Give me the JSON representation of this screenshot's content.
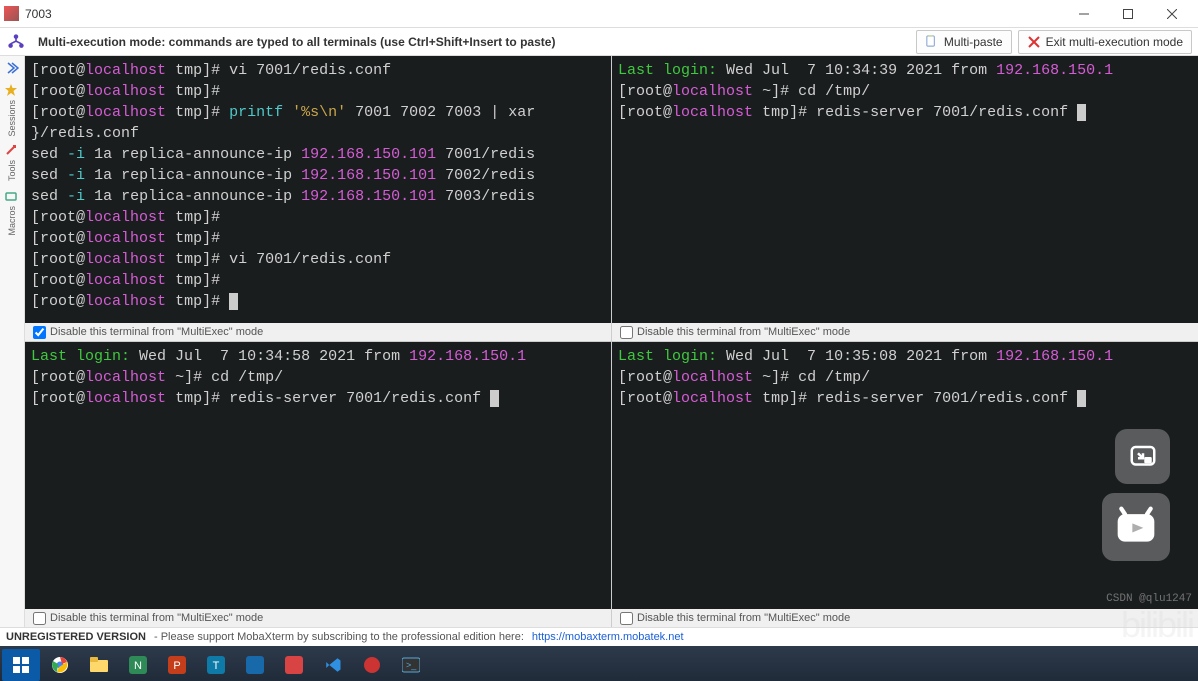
{
  "window": {
    "title": "7003"
  },
  "toolbar": {
    "mode_label": "Multi-execution mode: commands are typed to all terminals (use Ctrl+Shift+Insert to paste)",
    "multipaste_label": "Multi-paste",
    "exit_label": "Exit multi-execution mode"
  },
  "sidebar": {
    "items": [
      "Sessions",
      "Tools",
      "Macros"
    ]
  },
  "panes": [
    {
      "disable_label": "Disable this terminal from \"MultiExec\" mode",
      "disable_checked": true,
      "lines": {
        "prompt_user": "root",
        "prompt_host": "localhost",
        "prompt_path": "tmp",
        "l0_cmd": "vi 7001/redis.conf",
        "l2_cmd": "printf",
        "l2_arg1": "'%s\\n'",
        "l2_nums": "7001 7002 7003",
        "l2_pipe": "| xar",
        "l3": "}/redis.conf",
        "sed_cmd": "sed",
        "sed_flag": "-i",
        "sed_args": "1a replica-announce-ip",
        "sed_ip": "192.168.150.101",
        "sed_f1": "7001/redis",
        "sed_f2": "7002/redis",
        "sed_f3": "7003/redis",
        "l9_cmd": "vi 7001/redis.conf"
      }
    },
    {
      "disable_label": "Disable this terminal from \"MultiExec\" mode",
      "disable_checked": false,
      "lines": {
        "last_login_lbl": "Last login:",
        "last_login_date": "Wed Jul  7 10:34:39 2021 from",
        "last_login_ip": "192.168.150.1",
        "prompt_user": "root",
        "prompt_host": "localhost",
        "home_path": "~",
        "tmp_path": "tmp",
        "cd_cmd": "cd /tmp/",
        "redis_cmd": "redis-server 7001/redis.conf"
      }
    },
    {
      "disable_label": "Disable this terminal from \"MultiExec\" mode",
      "disable_checked": false,
      "lines": {
        "last_login_lbl": "Last login:",
        "last_login_date": "Wed Jul  7 10:34:58 2021 from",
        "last_login_ip": "192.168.150.1",
        "prompt_user": "root",
        "prompt_host": "localhost",
        "home_path": "~",
        "tmp_path": "tmp",
        "cd_cmd": "cd /tmp/",
        "redis_cmd": "redis-server 7001/redis.conf"
      }
    },
    {
      "disable_label": "Disable this terminal from \"MultiExec\" mode",
      "disable_checked": false,
      "lines": {
        "last_login_lbl": "Last login:",
        "last_login_date": "Wed Jul  7 10:35:08 2021 from",
        "last_login_ip": "192.168.150.1",
        "prompt_user": "root",
        "prompt_host": "localhost",
        "home_path": "~",
        "tmp_path": "tmp",
        "cd_cmd": "cd /tmp/",
        "redis_cmd": "redis-server 7001/redis.conf"
      }
    }
  ],
  "statusbar": {
    "unreg": "UNREGISTERED VERSION",
    "support": "- Please support MobaXterm by subscribing to the professional edition here:",
    "url": "https://mobaxterm.mobatek.net"
  },
  "watermark": "CSDN @qlu1247",
  "bili": "bilibili"
}
